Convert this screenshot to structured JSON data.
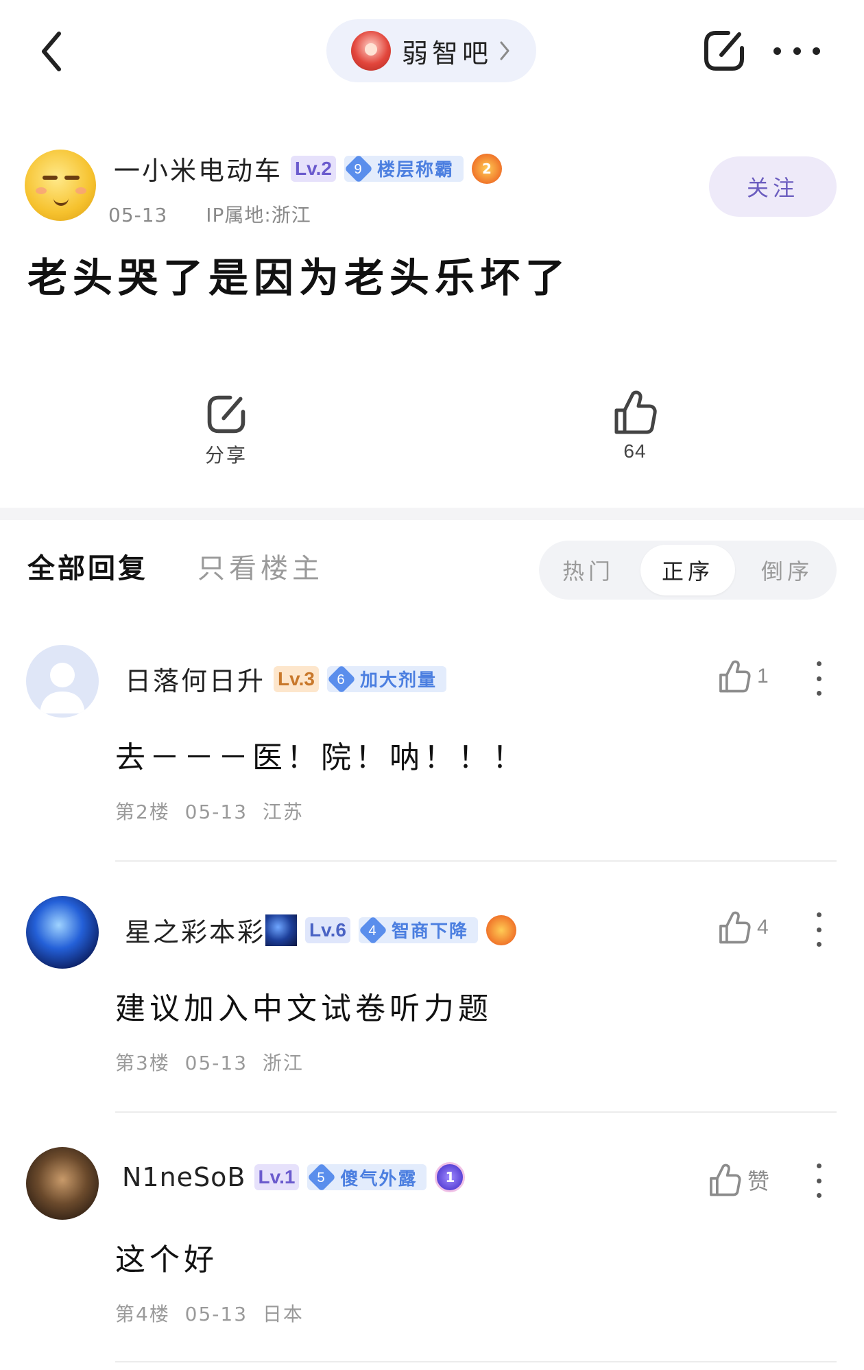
{
  "topbar": {
    "forum_name": "弱智吧"
  },
  "post": {
    "author": "一小米电动车",
    "level": "Lv.2",
    "title_badge_num": "9",
    "title_badge": "楼层称霸",
    "medal": "2",
    "date": "05-13",
    "ip": "IP属地:浙江",
    "follow_label": "关注",
    "title": "老头哭了是因为老头乐坏了",
    "share_label": "分享",
    "likes": "64"
  },
  "tabs": {
    "all": "全部回复",
    "op_only": "只看楼主"
  },
  "sort": {
    "hot": "热门",
    "asc": "正序",
    "desc": "倒序",
    "selected": "正序"
  },
  "replies": [
    {
      "user": "日落何日升",
      "level": "Lv.3",
      "badge_num": "6",
      "badge": "加大剂量",
      "content": "去－－－医！院！呐！！！",
      "floor": "第2楼",
      "date": "05-13",
      "loc": "江苏",
      "likes": "1"
    },
    {
      "user": "星之彩本彩",
      "level": "Lv.6",
      "badge_num": "4",
      "badge": "智商下降",
      "content": "建议加入中文试卷听力题",
      "floor": "第3楼",
      "date": "05-13",
      "loc": "浙江",
      "likes": "4"
    },
    {
      "user": "N1neSoB",
      "level": "Lv.1",
      "badge_num": "5",
      "badge": "傻气外露",
      "medal": "1",
      "content": "这个好",
      "floor": "第4楼",
      "date": "05-13",
      "loc": "日本",
      "likes": "赞"
    }
  ]
}
